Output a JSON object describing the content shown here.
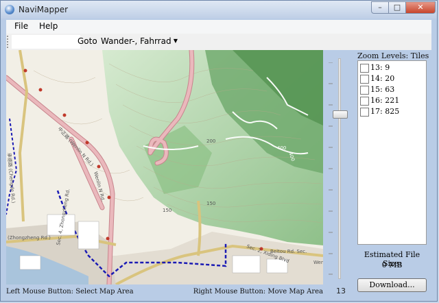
{
  "window": {
    "title": "NaviMapper",
    "app_icon": "globe-icon"
  },
  "window_controls": {
    "minimize": "–",
    "maximize": "□",
    "close": "✕"
  },
  "menu": {
    "items": [
      "File",
      "Help"
    ]
  },
  "toolbar": {
    "goto_label": "Goto",
    "search_value": "",
    "map_style_selected": "Wander-, Fahrrad"
  },
  "map": {
    "labels": {
      "road1": "中正路 (Wenlin N Rd.)",
      "road2": "Wenlin N Rd.",
      "road3": "(Zhongzheng Rd.)",
      "road4": "承德路 (Chengde Rd.)",
      "road5": "Sec. 4, Zhongzheng Rd.",
      "road6": "Beitou Rd. Sec.",
      "road7": "Sec. 2, Xiding Blvd",
      "elev1": "150",
      "elev2": "150",
      "elev3": "400",
      "elev4": "400",
      "elev5": "200",
      "elev6": "Wenl"
    }
  },
  "zoom": {
    "current_level": "13",
    "slider_position": 0.24,
    "levels_label": "Zoom Levels: Tiles",
    "levels": [
      {
        "label": "13: 9",
        "checked": false
      },
      {
        "label": "14: 20",
        "checked": false
      },
      {
        "label": "15: 63",
        "checked": false
      },
      {
        "label": "16: 221",
        "checked": false
      },
      {
        "label": "17: 825",
        "checked": false
      }
    ]
  },
  "estimate": {
    "label": "Estimated File Size:",
    "value": "0 MB"
  },
  "download_label": "Download...",
  "status": {
    "left": "Left Mouse Button: Select Map Area",
    "right": "Right Mouse Button: Move Map Area"
  },
  "colors": {
    "road_pink": "#e8b4b8",
    "road_border": "#c7848c",
    "green_dark": "#6aa86a",
    "green_light": "#c9e3b9",
    "water": "#a9c4dc",
    "route": "#1a1ab4"
  }
}
